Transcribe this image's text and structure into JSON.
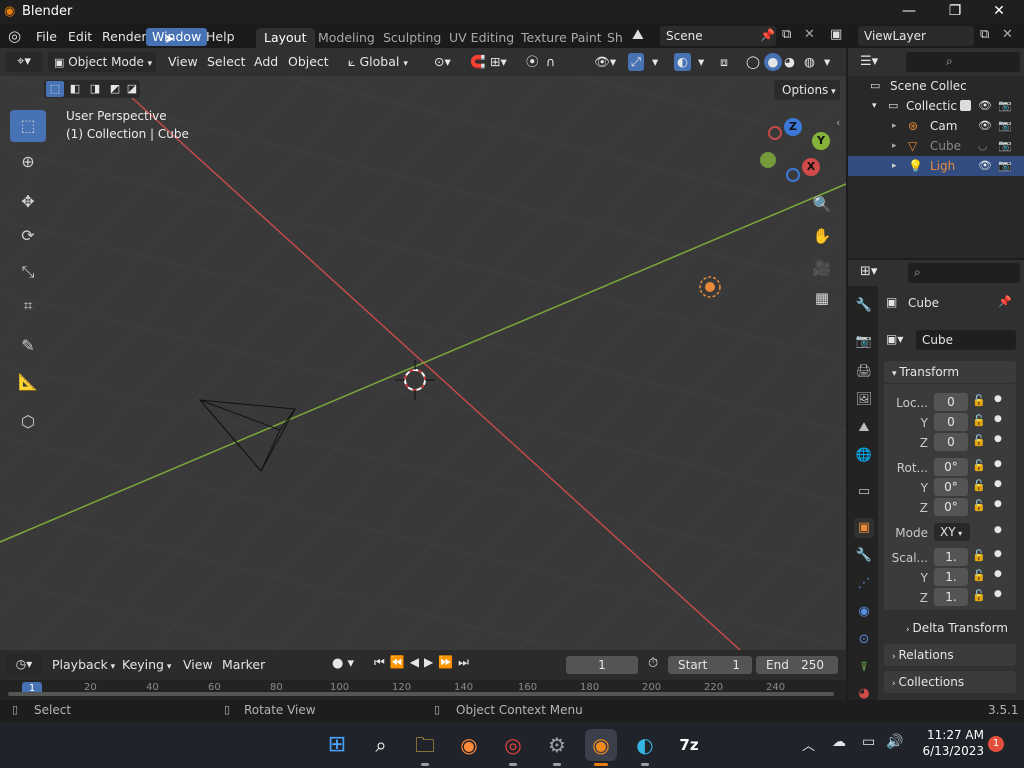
{
  "app": {
    "title": "Blender"
  },
  "window_controls": {
    "minimize": "—",
    "maximize": "❐",
    "close": "✕"
  },
  "menu": [
    "File",
    "Edit",
    "Render",
    "Window",
    "Help"
  ],
  "menu_active": "Window",
  "workspaces": [
    "Layout",
    "Modeling",
    "Sculpting",
    "UV Editing",
    "Texture Paint",
    "Sh"
  ],
  "workspace_active": "Layout",
  "scene": {
    "name": "Scene"
  },
  "viewlayer": {
    "name": "ViewLayer"
  },
  "viewport_header": {
    "mode": "Object Mode",
    "menus": [
      "View",
      "Select",
      "Add",
      "Object"
    ],
    "orientation": "Global",
    "options_label": "Options"
  },
  "viewport": {
    "perspective": "User Perspective",
    "collection_info": "(1) Collection | Cube"
  },
  "gizmo_axes": {
    "z": "Z",
    "y": "Y",
    "x": "X"
  },
  "tools": [
    "select-box-icon",
    "cursor-icon",
    "move-icon",
    "rotate-icon",
    "scale-icon",
    "transform-icon",
    "annotate-icon",
    "measure-icon",
    "add-cube-icon"
  ],
  "outliner": {
    "root": "Scene Collec",
    "collection": "Collectic",
    "items": [
      {
        "name": "Cam",
        "icon": "camera-icon",
        "color": "#e6e6e6"
      },
      {
        "name": "Cube",
        "icon": "mesh-icon",
        "color": "#8a8a8a"
      },
      {
        "name": "Ligh",
        "icon": "light-icon",
        "color": "#e88a3a"
      }
    ]
  },
  "properties": {
    "object_name": "Cube",
    "data_name": "Cube",
    "transform_label": "Transform",
    "location_label": "Loc...",
    "location": [
      "0",
      "0",
      "0"
    ],
    "rotation_label": "Rot...",
    "rotation": [
      "0°",
      "0°",
      "0°"
    ],
    "mode_label": "Mode",
    "mode_value": "XY",
    "scale_label": "Scal...",
    "scale": [
      "1.",
      "1.",
      "1."
    ],
    "axis_y": "Y",
    "axis_z": "Z",
    "delta_transform": "Delta Transform",
    "relations": "Relations",
    "collections": "Collections"
  },
  "timeline": {
    "menus": [
      "Playback",
      "Keying",
      "View",
      "Marker"
    ],
    "current_frame": "1",
    "start_label": "Start",
    "start": "1",
    "end_label": "End",
    "end": "250",
    "ticks": [
      "1",
      "20",
      "40",
      "60",
      "80",
      "100",
      "120",
      "140",
      "160",
      "180",
      "200",
      "220",
      "240"
    ]
  },
  "statusbar": {
    "left": "Select",
    "middle": "Rotate View",
    "right": "Object Context Menu",
    "version": "3.5.1"
  },
  "taskbar": {
    "time": "11:27 AM",
    "date": "6/13/2023",
    "notifications": "1",
    "apps": [
      "windows-start-icon",
      "search-icon",
      "file-explorer-icon",
      "firefox-icon",
      "chrome-icon",
      "settings-icon",
      "blender-icon",
      "edge-icon",
      "7zip-icon"
    ],
    "seven_zip_label": "7z"
  },
  "colors": {
    "accent": "#4772b3",
    "x_axis": "#e06060",
    "y_axis": "#85b33a",
    "light_orange": "#e88a3a"
  }
}
